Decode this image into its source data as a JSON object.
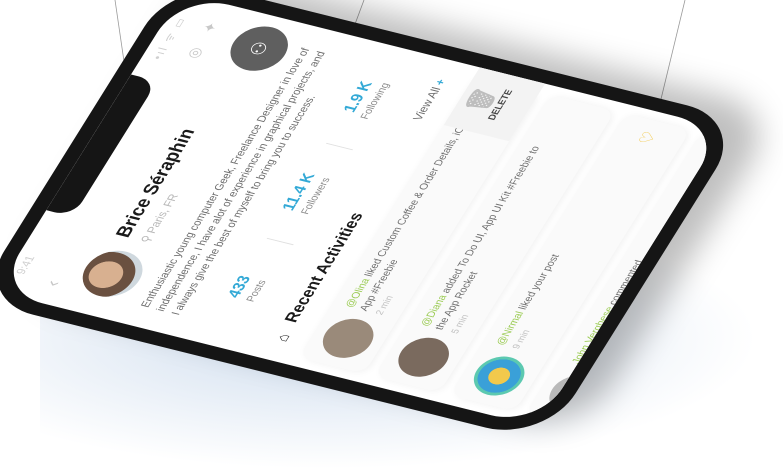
{
  "status": {
    "time": "9:41",
    "signal": "•ıl ᯤ ▭"
  },
  "top_icons": [
    "dribbble-icon",
    "twitter-icon"
  ],
  "profile": {
    "name": "Brice Séraphin",
    "location": "Paris, FR",
    "bio": "Enthusiastic young computer Geek, Freelance Designer in love of independence, I have alot of experience in graphical projects, and I always give the best of myself to bring you to success."
  },
  "stats": [
    {
      "value": "433",
      "label": "Posts"
    },
    {
      "value": "11.4 K",
      "label": "Followers"
    },
    {
      "value": "1.9 K",
      "label": "Following"
    }
  ],
  "activities": {
    "title": "Recent Activities",
    "view_all": "View All",
    "delete_label": "DELETE",
    "items": [
      {
        "user": "@Olina",
        "verb": "liked",
        "text": "Custom Coffee & Order Details, iOS App #Freebie",
        "time": "2 min"
      },
      {
        "user": "@Diana",
        "verb": "added",
        "text": "To Do UI, App UI Kit #Freebie to the App Rocket",
        "time": "5 min"
      },
      {
        "user": "@Nirmal",
        "verb": "liked your post",
        "text": "",
        "time": "9 min"
      },
      {
        "user": "John Verghese",
        "verb": "commented",
        "text": "",
        "time": ""
      }
    ]
  },
  "colors": {
    "accent_blue": "#33a9d6",
    "accent_green": "#9acb52",
    "teal_dot": "#5cc9b0",
    "like_pink": "#e86a8c"
  }
}
